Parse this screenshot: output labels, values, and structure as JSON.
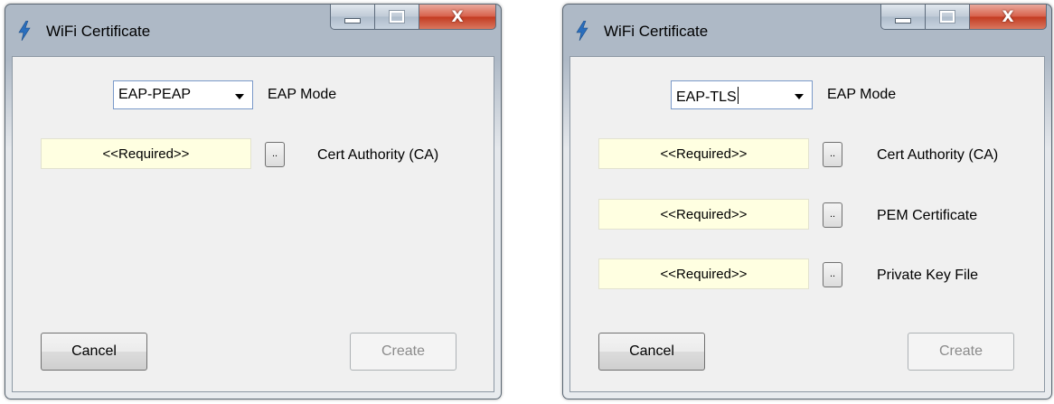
{
  "windows": [
    {
      "title": "WiFi Certificate",
      "caption_buttons": {
        "close": "X"
      },
      "eap_mode": {
        "value": "EAP-PEAP",
        "label": "EAP Mode"
      },
      "fields": [
        {
          "placeholder": "<<Required>>",
          "browse_label": "..",
          "label": "Cert Authority (CA)"
        }
      ],
      "buttons": {
        "cancel": "Cancel",
        "create": "Create"
      }
    },
    {
      "title": "WiFi Certificate",
      "caption_buttons": {
        "close": "X"
      },
      "eap_mode": {
        "value": "EAP-TLS",
        "label": "EAP Mode"
      },
      "fields": [
        {
          "placeholder": "<<Required>>",
          "browse_label": "..",
          "label": "Cert Authority (CA)"
        },
        {
          "placeholder": "<<Required>>",
          "browse_label": "..",
          "label": "PEM Certificate"
        },
        {
          "placeholder": "<<Required>>",
          "browse_label": "..",
          "label": "Private Key File"
        }
      ],
      "buttons": {
        "cancel": "Cancel",
        "create": "Create"
      }
    }
  ],
  "colors": {
    "required_field_bg": "#ffffe1",
    "close_button": "#c7432a",
    "disabled_text": "#8b8b8b"
  },
  "icons": {
    "title": "lightning-bolt-icon",
    "minimize": "minimize-icon",
    "maximize": "maximize-icon",
    "close": "close-icon",
    "dropdown": "chevron-down-icon"
  }
}
